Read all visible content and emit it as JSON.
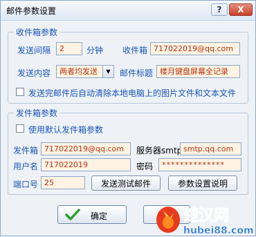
{
  "window": {
    "title": "邮件参数设置",
    "help_symbol": "?",
    "close_symbol": "X"
  },
  "inbox": {
    "group_title": "收件箱参数",
    "interval_label": "发送间隔",
    "interval_value": "2",
    "interval_unit": "分钟",
    "inbox_label": "收件箱",
    "inbox_value": "717022019@qq.com",
    "content_label": "发送内容",
    "content_selected": "两者均发送",
    "subject_label": "邮件标题",
    "subject_value": "楼月键盘屏幕全记录",
    "clear_after_send_label": "发送完邮件后自动清除本地电脑上的图片文件和文本文件"
  },
  "outbox": {
    "group_title": "发件箱参数",
    "use_default_label": "使用默认发件箱参数",
    "sender_label": "发件箱",
    "sender_value": "717022019@qq.com",
    "smtp_label": "服务器smtp",
    "smtp_value": "smtp.qq.com",
    "username_label": "用户名",
    "username_value": "717022019",
    "password_label": "密码",
    "password_value": "**************",
    "port_label": "端口号",
    "port_value": "25",
    "send_test_label": "发送测试邮件",
    "help_label": "参数设置说明"
  },
  "footer": {
    "ok_label": "确定"
  },
  "watermark": {
    "name": "楚汉网",
    "site": "hubei88.com"
  },
  "colors": {
    "accent": "#1b55b5",
    "field_bg": "#fff3e4",
    "field_text": "#b3340e"
  }
}
